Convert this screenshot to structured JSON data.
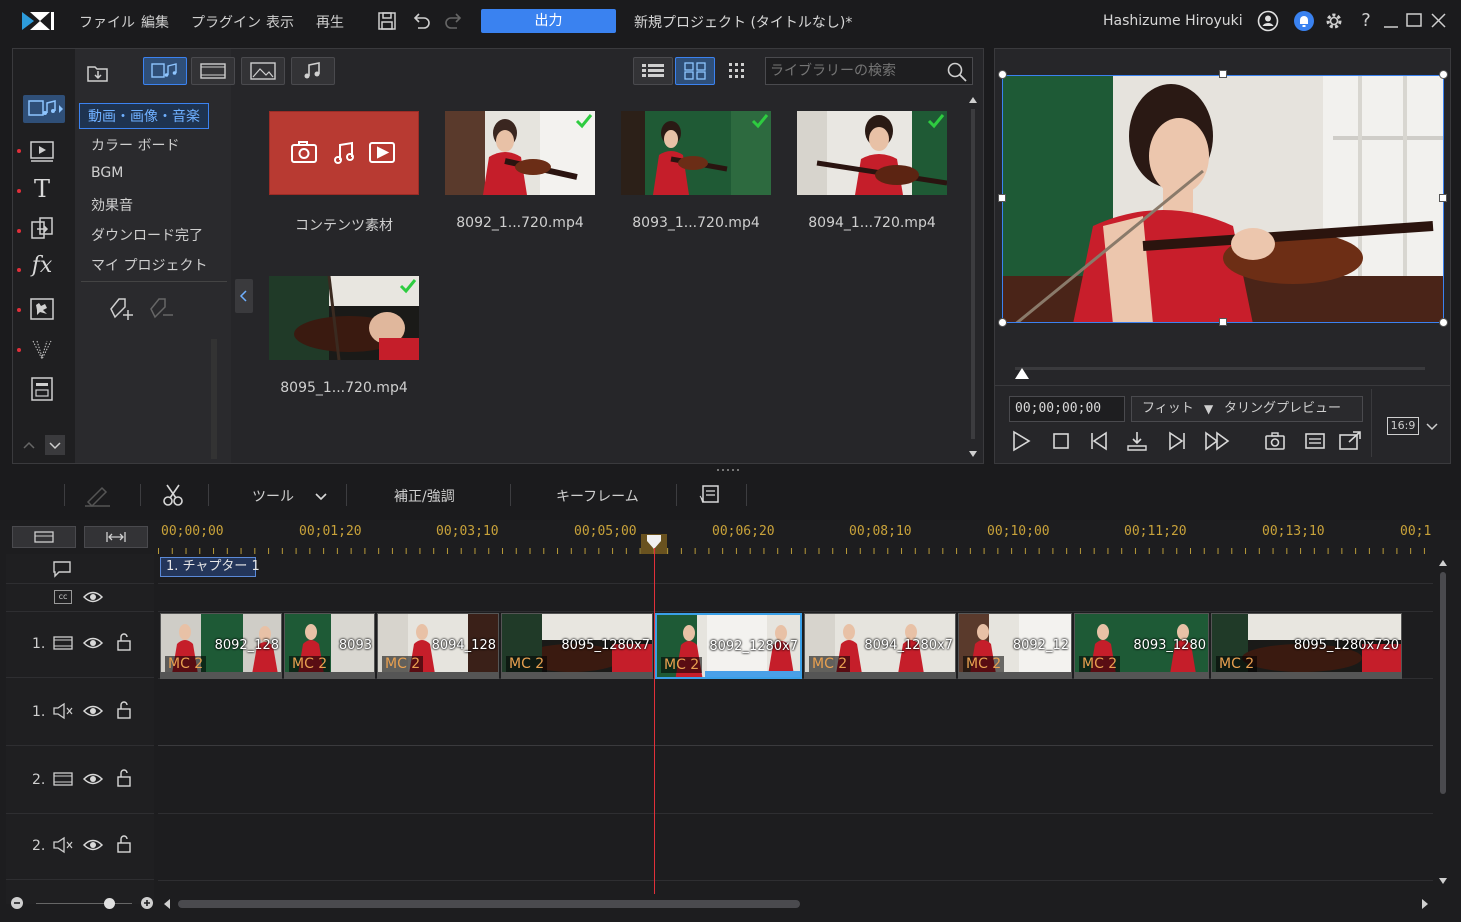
{
  "menubar": {
    "items": [
      "ファイル",
      "編集",
      "プラグイン",
      "表示",
      "再生"
    ],
    "export_label": "出力",
    "project_title": "新規プロジェクト (タイトルなし)*",
    "user_name": "Hashizume Hiroyuki"
  },
  "library": {
    "categories": [
      "動画・画像・音楽",
      "カラー ボード",
      "BGM",
      "効果音",
      "ダウンロード完了",
      "マイ プロジェクト"
    ],
    "search_placeholder": "ライブラリーの検索",
    "media": [
      {
        "label": "コンテンツ素材",
        "kind": "content"
      },
      {
        "label": "8092_1...720.mp4",
        "kind": "video",
        "checked": true
      },
      {
        "label": "8093_1...720.mp4",
        "kind": "video",
        "checked": true
      },
      {
        "label": "8094_1...720.mp4",
        "kind": "video",
        "checked": true
      },
      {
        "label": "8095_1...720.mp4",
        "kind": "video",
        "checked": true
      }
    ]
  },
  "preview": {
    "timecode": "00;00;00;00",
    "fit_label": "フィット",
    "mode_label": "タリングプレビュー",
    "aspect": "16:9"
  },
  "edit_toolbar": {
    "tools_label": "ツール",
    "correction_label": "補正/強調",
    "keyframe_label": "キーフレーム"
  },
  "timeline": {
    "ruler": [
      "00;00;00",
      "00;01;20",
      "00;03;10",
      "00;05;00",
      "00;06;20",
      "00;08;10",
      "00;10;00",
      "00;11;20",
      "00;13;10",
      "00;1"
    ],
    "chapter_label": "1. チャプター 1",
    "tracks": [
      {
        "num": "1.",
        "type": "video"
      },
      {
        "num": "1.",
        "type": "audio"
      },
      {
        "num": "2.",
        "type": "video"
      },
      {
        "num": "2.",
        "type": "audio"
      }
    ],
    "clips": [
      {
        "label": "8092_128",
        "mc": "MC 2"
      },
      {
        "label": "8093",
        "mc": "MC 2"
      },
      {
        "label": "8094_128",
        "mc": "MC 2"
      },
      {
        "label": "8095_1280x7",
        "mc": "MC 2"
      },
      {
        "label": "8092_1280x7",
        "mc": "MC 2",
        "selected": true
      },
      {
        "label": "8094_1280x7",
        "mc": "MC 2"
      },
      {
        "label": "8092_12",
        "mc": "MC 2"
      },
      {
        "label": "8093_1280",
        "mc": "MC 2"
      },
      {
        "label": "8095_1280x720",
        "mc": "MC 2"
      }
    ]
  }
}
